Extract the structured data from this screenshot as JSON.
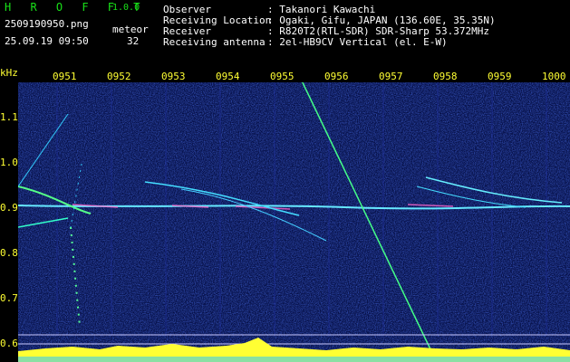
{
  "app": {
    "title": "H R O F F T",
    "version": "1.0.0"
  },
  "file": {
    "name": "2509190950.png",
    "datetime": "25.09.19 09:50"
  },
  "counter": {
    "label": "meteor",
    "value": "32"
  },
  "info": [
    {
      "key": "Observer",
      "value": ": Takanori Kawachi"
    },
    {
      "key": "Receiving Location",
      "value": ": Ogaki, Gifu, JAPAN (136.60E, 35.35N)"
    },
    {
      "key": "Receiver",
      "value": ": R820T2(RTL-SDR) SDR-Sharp 53.372MHz"
    },
    {
      "key": "Receiving antenna",
      "value": ": 2el-HB9CV Vertical (el. E-W)"
    }
  ],
  "axis": {
    "unit": "kHz",
    "time_ticks": [
      "0951",
      "0952",
      "0953",
      "0954",
      "0955",
      "0956",
      "0957",
      "0958",
      "0959",
      "1000"
    ],
    "freq_ticks": [
      "1.1",
      "1.0",
      "0.9",
      "0.8",
      "0.7",
      "0.6"
    ]
  },
  "colors": {
    "background": "#000000",
    "spectrogram": "#0a1670",
    "label": "#ffff33",
    "header": "#19e019"
  }
}
